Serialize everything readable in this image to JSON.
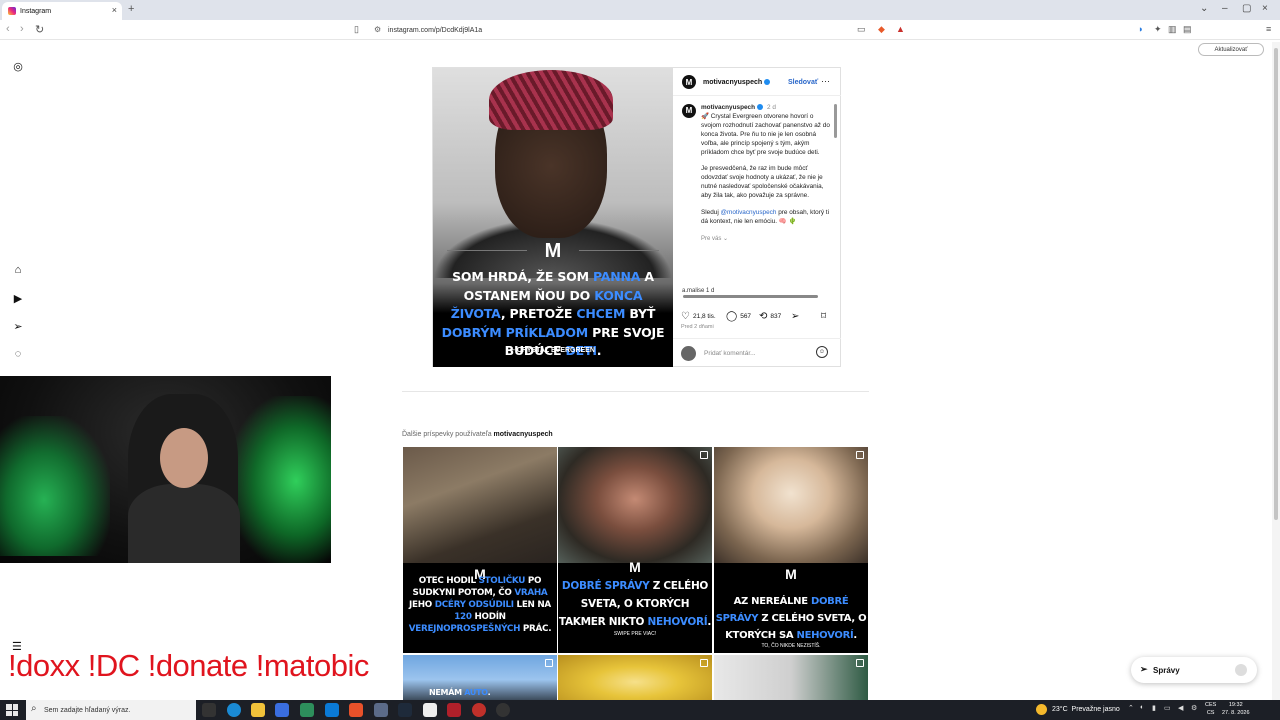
{
  "browser": {
    "tab_title": "Instagram",
    "url": "instagram.com/p/DcdKdj9lA1a",
    "update_button": "Aktualizovať"
  },
  "post": {
    "username": "motivacnyuspech",
    "follow_label": "Sledovať",
    "image": {
      "quote_parts": [
        "SOM HRDÁ, ŽE SOM ",
        "PANNA",
        " A OSTANEM ŇOU DO ",
        "KONCA ŽIVOTA",
        ", PRETOŽE ",
        "CHCEM",
        " BYŤ ",
        "DOBRÝM PRÍKLADOM",
        " PRE SVOJE BUDÚCE ",
        "DETI",
        "."
      ],
      "author": "– CRYSTAL EVERGREEN"
    },
    "caption": {
      "username": "motivacnyuspech",
      "time": "2 d",
      "paragraph1": "🚀 Crystal Evergreen otvorene hovorí o svojom rozhodnutí zachovať panenstvo až do konca života. Pre ňu to nie je len osobná voľba, ale princíp spojený s tým, akým príkladom chce byť pre svoje budúce deti.",
      "paragraph2": "Je presvedčená, že raz im bude môcť odovzdať svoje hodnoty a ukázať, že nie je nutné nasledovať spoločenské očakávania, aby žila tak, ako považuje za správne.",
      "paragraph3_pre": "Sleduj ",
      "paragraph3_mention": "@motivacnyuspech",
      "paragraph3_post": " pre obsah, ktorý ti dá kontext, nie len emóciu. 🧠 🌵",
      "replies": "Pre vás ⌄",
      "next_comment": "a.malise  1 d"
    },
    "likes": "21,8 tis.",
    "comments": "567",
    "reposts": "837",
    "date": "Pred 2 dňami",
    "comment_placeholder": "Pridať komentár..."
  },
  "more_posts": {
    "title_prefix": "Ďalšie príspevky používateľa ",
    "title_user": "motivacnyuspech",
    "tiles": [
      {
        "parts": [
          "OTEC HODIL ",
          "STOLIČKU",
          " PO SUDKYNI POTOM, ČO ",
          "VRAHA",
          " JEHO ",
          "DCÉRY ODSÚDILI",
          " LEN NA ",
          "120",
          " HODÍN ",
          "VEREJNOPROSPEŠNÝCH",
          " PRÁC."
        ]
      },
      {
        "parts": [
          "DOBRÉ SPRÁVY",
          " Z CELÉHO SVETA, O KTORÝCH TAKMER NIKTO ",
          "NEHOVORÍ",
          "."
        ],
        "sub": "SWIPE PRE VIAC!"
      },
      {
        "parts": [
          "AZ NEREÁLNE ",
          "DOBRÉ SPRÁVY",
          " Z CELÉHO SVETA, O KTORÝCH SA ",
          "NEHOVORÍ",
          "."
        ],
        "sub": "TO, ČO NIKDE NEZISTÍŠ."
      },
      {
        "parts": [
          "NEMÁM ",
          "AUTO",
          "."
        ]
      }
    ]
  },
  "stream_overlay": "!doxx  !DC !donate !matobic",
  "messages_label": "Správy",
  "taskbar": {
    "search_placeholder": "Sem zadajte hľadaný výraz.",
    "weather_temp": "23°C",
    "weather_desc": "Prevažne jasno",
    "lang_top": "CES",
    "lang_bottom": "CS",
    "time": "19:32",
    "date": "27. 8. 2026"
  },
  "colors": {
    "highlight_blue": "#3c8cff",
    "link_blue": "#2866c9",
    "overlay_red": "#e0141e",
    "webcam_green": "#2ee86b"
  },
  "icons": [
    "instagram-icon",
    "home-icon",
    "reels-icon",
    "send-icon",
    "loading-icon",
    "heart-icon",
    "comment-icon",
    "repost-icon",
    "share-icon",
    "bookmark-icon",
    "emoji-icon",
    "more-icon",
    "menu-icon"
  ]
}
